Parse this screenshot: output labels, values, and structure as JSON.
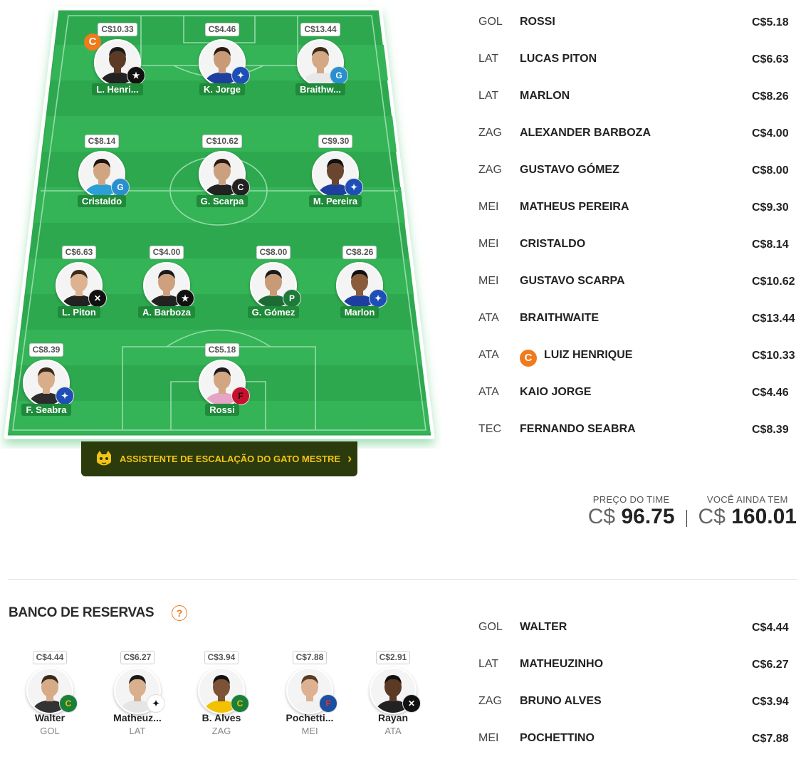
{
  "field": {
    "starters": [
      {
        "id": "henrique",
        "short": "L. Henri...",
        "price": "C$10.33",
        "captain": true,
        "captain_letter": "C",
        "club": "botafogo",
        "skin": "#5b3a26",
        "hair": "#1a1a1a",
        "shirt": "#222"
      },
      {
        "id": "kjorge",
        "short": "K. Jorge",
        "price": "C$4.46",
        "captain": false,
        "club": "cruzeiro",
        "skin": "#c89a78",
        "hair": "#2a1a10",
        "shirt": "#1e3fa0"
      },
      {
        "id": "braith",
        "short": "Braithw...",
        "price": "C$13.44",
        "captain": false,
        "club": "gremio",
        "skin": "#d4a883",
        "hair": "#3a2a1a",
        "shirt": "#e8e8e8"
      },
      {
        "id": "cristaldo",
        "short": "Cristaldo",
        "price": "C$8.14",
        "captain": false,
        "club": "gremio",
        "skin": "#d2a582",
        "hair": "#1c1410",
        "shirt": "#2a9fd8"
      },
      {
        "id": "scarpa",
        "short": "G. Scarpa",
        "price": "C$10.62",
        "captain": false,
        "club": "atletico",
        "skin": "#caa07e",
        "hair": "#2b1a10",
        "shirt": "#222"
      },
      {
        "id": "mpereira",
        "short": "M. Pereira",
        "price": "C$9.30",
        "captain": false,
        "club": "cruzeiro",
        "skin": "#6a4630",
        "hair": "#111",
        "shirt": "#1e3fa0"
      },
      {
        "id": "piton",
        "short": "L. Piton",
        "price": "C$6.63",
        "captain": false,
        "club": "vasco",
        "skin": "#dcb290",
        "hair": "#3d2b1c",
        "shirt": "#222"
      },
      {
        "id": "barboza",
        "short": "A. Barboza",
        "price": "C$4.00",
        "captain": false,
        "club": "botafogo",
        "skin": "#cfa07d",
        "hair": "#1a1a1a",
        "shirt": "#222"
      },
      {
        "id": "gomez",
        "short": "G. Gómez",
        "price": "C$8.00",
        "captain": false,
        "club": "palmeiras",
        "skin": "#c99a76",
        "hair": "#1a1a1a",
        "shirt": "#1d6b34"
      },
      {
        "id": "marlon",
        "short": "Marlon",
        "price": "C$8.26",
        "captain": false,
        "club": "cruzeiro",
        "skin": "#8a5c3c",
        "hair": "#111",
        "shirt": "#1e3fa0"
      },
      {
        "id": "seabra",
        "short": "F. Seabra",
        "price": "C$8.39",
        "captain": false,
        "club": "cruzeiro",
        "skin": "#d8ad8a",
        "hair": "#3a2a1a",
        "shirt": "#2c2c2c"
      },
      {
        "id": "rossi",
        "short": "Rossi",
        "price": "C$5.18",
        "captain": false,
        "club": "flamengo",
        "skin": "#d3a682",
        "hair": "#1a1a1a",
        "shirt": "#e7a5c6"
      }
    ],
    "assistant_label": "ASSISTENTE DE ESCALAÇÃO DO GATO MESTRE",
    "assistant_chevron": "›"
  },
  "lineup": [
    {
      "pos": "GOL",
      "name": "ROSSI",
      "price": "C$5.18",
      "captain": false
    },
    {
      "pos": "LAT",
      "name": "LUCAS PITON",
      "price": "C$6.63",
      "captain": false
    },
    {
      "pos": "LAT",
      "name": "MARLON",
      "price": "C$8.26",
      "captain": false
    },
    {
      "pos": "ZAG",
      "name": "ALEXANDER BARBOZA",
      "price": "C$4.00",
      "captain": false
    },
    {
      "pos": "ZAG",
      "name": "GUSTAVO GÓMEZ",
      "price": "C$8.00",
      "captain": false
    },
    {
      "pos": "MEI",
      "name": "MATHEUS PEREIRA",
      "price": "C$9.30",
      "captain": false
    },
    {
      "pos": "MEI",
      "name": "CRISTALDO",
      "price": "C$8.14",
      "captain": false
    },
    {
      "pos": "MEI",
      "name": "GUSTAVO SCARPA",
      "price": "C$10.62",
      "captain": false
    },
    {
      "pos": "ATA",
      "name": "BRAITHWAITE",
      "price": "C$13.44",
      "captain": false
    },
    {
      "pos": "ATA",
      "name": "LUIZ HENRIQUE",
      "price": "C$10.33",
      "captain": true,
      "captain_letter": "C"
    },
    {
      "pos": "ATA",
      "name": "KAIO JORGE",
      "price": "C$4.46",
      "captain": false
    },
    {
      "pos": "TEC",
      "name": "FERNANDO SEABRA",
      "price": "C$8.39",
      "captain": false
    }
  ],
  "totals": {
    "team_price_label": "PREÇO DO TIME",
    "team_price_currency": "C$",
    "team_price_value": "96.75",
    "remaining_label": "VOCÊ AINDA TEM",
    "remaining_currency": "C$",
    "remaining_value": "160.01"
  },
  "bench": {
    "title": "BANCO DE RESERVAS",
    "help_glyph": "?",
    "players": [
      {
        "name": "Walter",
        "pos": "GOL",
        "price": "C$4.44",
        "club": "cuiaba",
        "skin": "#d6ab88",
        "hair": "#3a2a1a",
        "shirt": "#333"
      },
      {
        "name": "Matheuz...",
        "pos": "LAT",
        "price": "C$6.27",
        "club": "corinthians",
        "skin": "#d9b08d",
        "hair": "#1a1a1a",
        "shirt": "#e5e5e5"
      },
      {
        "name": "B. Alves",
        "pos": "ZAG",
        "price": "C$3.94",
        "club": "cuiaba",
        "skin": "#7d5236",
        "hair": "#111",
        "shirt": "#f2c200"
      },
      {
        "name": "Pochetti...",
        "pos": "MEI",
        "price": "C$7.88",
        "club": "fortaleza",
        "skin": "#dcb292",
        "hair": "#5a3d22",
        "shirt": "#f1f1f1"
      },
      {
        "name": "Rayan",
        "pos": "ATA",
        "price": "C$2.91",
        "club": "vasco",
        "skin": "#5a3a25",
        "hair": "#111",
        "shirt": "#222"
      }
    ]
  },
  "bench_list": [
    {
      "pos": "GOL",
      "name": "WALTER",
      "price": "C$4.44"
    },
    {
      "pos": "LAT",
      "name": "MATHEUZINHO",
      "price": "C$6.27"
    },
    {
      "pos": "ZAG",
      "name": "BRUNO ALVES",
      "price": "C$3.94"
    },
    {
      "pos": "MEI",
      "name": "POCHETTINO",
      "price": "C$7.88"
    }
  ],
  "colors": {
    "pitch": "#2fa84f",
    "pitch_stripe": "#35b357",
    "captain": "#f07a1c",
    "assistant_bg": "#2b3b0c",
    "assistant_text": "#f3c316"
  }
}
